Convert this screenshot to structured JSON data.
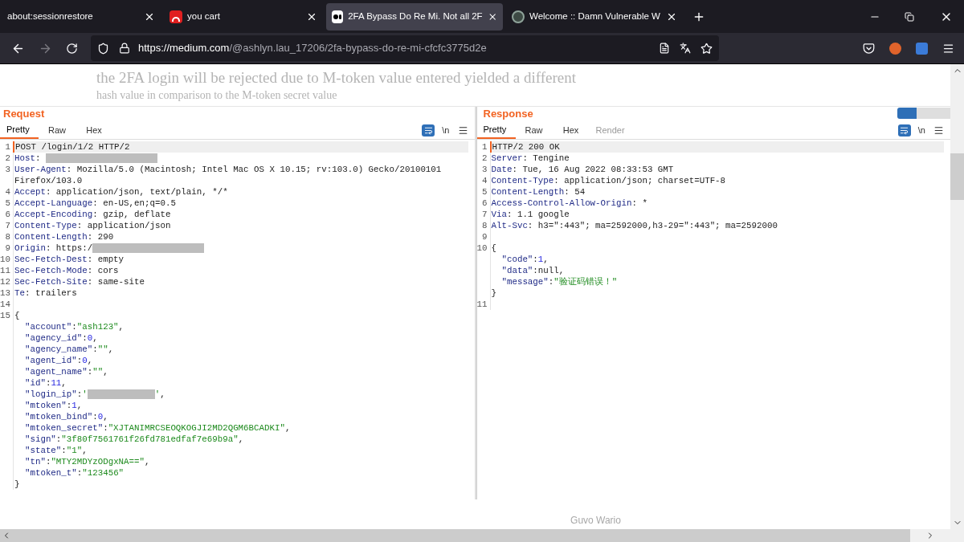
{
  "browser": {
    "tabs": [
      {
        "title": "about:sessionrestore",
        "selected": false,
        "kind": "plain"
      },
      {
        "title": "you cart",
        "selected": false,
        "kind": "cart"
      },
      {
        "title": "2FA Bypass Do Re Mi. Not all 2F",
        "selected": true,
        "kind": "medium"
      },
      {
        "title": "Welcome :: Damn Vulnerable W",
        "selected": false,
        "kind": "globe"
      }
    ],
    "url_host": "https://medium.com",
    "url_path": "/@ashlyn.lau_17206/2fa-bypass-do-re-mi-cfcfc3775d2e"
  },
  "article": {
    "lines": [
      "the 2FA login will be rejected due to M-token value entered yielded a different",
      "hash value in comparison to the M-token secret value"
    ],
    "footer_name": "Guvo Wario"
  },
  "request": {
    "title": "Request",
    "tabs": [
      {
        "label": "Pretty",
        "selected": true,
        "disabled": false
      },
      {
        "label": "Raw",
        "selected": false,
        "disabled": false
      },
      {
        "label": "Hex",
        "selected": false,
        "disabled": false
      }
    ],
    "newline_label": "\\n",
    "lines": [
      {
        "num": "1",
        "highlight": true,
        "parts": [
          {
            "kind": "text",
            "text": "POST /login/1/2 HTTP/2"
          }
        ]
      },
      {
        "num": "2",
        "parts": [
          {
            "kind": "key",
            "text": "Host"
          },
          {
            "kind": "text",
            "text": ": "
          },
          {
            "kind": "redacted"
          }
        ]
      },
      {
        "num": "3",
        "parts": [
          {
            "kind": "key",
            "text": "User-Agent"
          },
          {
            "kind": "text",
            "text": ": Mozilla/5.0 (Macintosh; Intel Mac OS X 10.15; rv:103.0) Gecko/20100101"
          }
        ]
      },
      {
        "parts": [
          {
            "kind": "text",
            "text": "Firefox/103.0"
          }
        ]
      },
      {
        "num": "4",
        "parts": [
          {
            "kind": "key",
            "text": "Accept"
          },
          {
            "kind": "text",
            "text": ": application/json, text/plain, */*"
          }
        ]
      },
      {
        "num": "5",
        "parts": [
          {
            "kind": "key",
            "text": "Accept-Language"
          },
          {
            "kind": "text",
            "text": ": en-US,en;q=0.5"
          }
        ]
      },
      {
        "num": "6",
        "parts": [
          {
            "kind": "key",
            "text": "Accept-Encoding"
          },
          {
            "kind": "text",
            "text": ": gzip, deflate"
          }
        ]
      },
      {
        "num": "7",
        "parts": [
          {
            "kind": "key",
            "text": "Content-Type"
          },
          {
            "kind": "text",
            "text": ": application/json"
          }
        ]
      },
      {
        "num": "8",
        "parts": [
          {
            "kind": "key",
            "text": "Content-Length"
          },
          {
            "kind": "text",
            "text": ": 290"
          }
        ]
      },
      {
        "num": "9",
        "parts": [
          {
            "kind": "key",
            "text": "Origin"
          },
          {
            "kind": "text",
            "text": ": https:/"
          },
          {
            "kind": "redacted"
          }
        ]
      },
      {
        "num": "10",
        "parts": [
          {
            "kind": "key",
            "text": "Sec-Fetch-Dest"
          },
          {
            "kind": "text",
            "text": ": empty"
          }
        ]
      },
      {
        "num": "11",
        "parts": [
          {
            "kind": "key",
            "text": "Sec-Fetch-Mode"
          },
          {
            "kind": "text",
            "text": ": cors"
          }
        ]
      },
      {
        "num": "12",
        "parts": [
          {
            "kind": "key",
            "text": "Sec-Fetch-Site"
          },
          {
            "kind": "text",
            "text": ": same-site"
          }
        ]
      },
      {
        "num": "13",
        "parts": [
          {
            "kind": "key",
            "text": "Te"
          },
          {
            "kind": "text",
            "text": ": trailers"
          }
        ]
      },
      {
        "num": "14"
      },
      {
        "num": "15",
        "parts": [
          {
            "kind": "text",
            "text": "{"
          }
        ]
      },
      {
        "parts": [
          {
            "kind": "key",
            "text": "  \"account\""
          },
          {
            "kind": "text",
            "text": ":"
          },
          {
            "kind": "string",
            "text": "\"ash123\""
          },
          {
            "kind": "text",
            "text": ","
          }
        ]
      },
      {
        "parts": [
          {
            "kind": "key",
            "text": "  \"agency_id\""
          },
          {
            "kind": "text",
            "text": ":"
          },
          {
            "kind": "number",
            "text": "0"
          },
          {
            "kind": "text",
            "text": ","
          }
        ]
      },
      {
        "parts": [
          {
            "kind": "key",
            "text": "  \"agency_name\""
          },
          {
            "kind": "text",
            "text": ":"
          },
          {
            "kind": "string",
            "text": "\"\""
          },
          {
            "kind": "text",
            "text": ","
          }
        ]
      },
      {
        "parts": [
          {
            "kind": "key",
            "text": "  \"agent_id\""
          },
          {
            "kind": "text",
            "text": ":"
          },
          {
            "kind": "number",
            "text": "0"
          },
          {
            "kind": "text",
            "text": ","
          }
        ]
      },
      {
        "parts": [
          {
            "kind": "key",
            "text": "  \"agent_name\""
          },
          {
            "kind": "text",
            "text": ":"
          },
          {
            "kind": "string",
            "text": "\"\""
          },
          {
            "kind": "text",
            "text": ","
          }
        ]
      },
      {
        "parts": [
          {
            "kind": "key",
            "text": "  \"id\""
          },
          {
            "kind": "text",
            "text": ":"
          },
          {
            "kind": "number",
            "text": "11"
          },
          {
            "kind": "text",
            "text": ","
          }
        ]
      },
      {
        "parts": [
          {
            "kind": "key",
            "text": "  \"login_ip\""
          },
          {
            "kind": "text",
            "text": ":"
          },
          {
            "kind": "string",
            "text": "'"
          },
          {
            "kind": "redacted"
          },
          {
            "kind": "string",
            "text": "'"
          },
          {
            "kind": "text",
            "text": ","
          }
        ]
      },
      {
        "parts": [
          {
            "kind": "key",
            "text": "  \"mtoken\""
          },
          {
            "kind": "text",
            "text": ":"
          },
          {
            "kind": "number",
            "text": "1"
          },
          {
            "kind": "text",
            "text": ","
          }
        ]
      },
      {
        "parts": [
          {
            "kind": "key",
            "text": "  \"mtoken_bind\""
          },
          {
            "kind": "text",
            "text": ":"
          },
          {
            "kind": "number",
            "text": "0"
          },
          {
            "kind": "text",
            "text": ","
          }
        ]
      },
      {
        "parts": [
          {
            "kind": "key",
            "text": "  \"mtoken_secret\""
          },
          {
            "kind": "text",
            "text": ":"
          },
          {
            "kind": "string",
            "text": "\"XJTANIMRCSEOQKOGJI2MD2QGM6BCADKI\""
          },
          {
            "kind": "text",
            "text": ","
          }
        ]
      },
      {
        "parts": [
          {
            "kind": "key",
            "text": "  \"sign\""
          },
          {
            "kind": "text",
            "text": ":"
          },
          {
            "kind": "string",
            "text": "\"3f80f7561761f26fd781edfaf7e69b9a\""
          },
          {
            "kind": "text",
            "text": ","
          }
        ]
      },
      {
        "parts": [
          {
            "kind": "key",
            "text": "  \"state\""
          },
          {
            "kind": "text",
            "text": ":"
          },
          {
            "kind": "string",
            "text": "\"1\""
          },
          {
            "kind": "text",
            "text": ","
          }
        ]
      },
      {
        "parts": [
          {
            "kind": "key",
            "text": "  \"tn\""
          },
          {
            "kind": "text",
            "text": ":"
          },
          {
            "kind": "string",
            "text": "\"MTY2MDYzODgxNA==\""
          },
          {
            "kind": "text",
            "text": ","
          }
        ]
      },
      {
        "parts": [
          {
            "kind": "key",
            "text": "  \"mtoken_t\""
          },
          {
            "kind": "text",
            "text": ":"
          },
          {
            "kind": "string",
            "text": "\"123456\""
          }
        ]
      },
      {
        "parts": [
          {
            "kind": "text",
            "text": "}"
          }
        ]
      }
    ]
  },
  "response": {
    "title": "Response",
    "tabs": [
      {
        "label": "Pretty",
        "selected": true,
        "disabled": false
      },
      {
        "label": "Raw",
        "selected": false,
        "disabled": false
      },
      {
        "label": "Hex",
        "selected": false,
        "disabled": false
      },
      {
        "label": "Render",
        "selected": false,
        "disabled": true
      }
    ],
    "newline_label": "\\n",
    "lines": [
      {
        "num": "1",
        "highlight": true,
        "parts": [
          {
            "kind": "text",
            "text": "HTTP/2 200 OK"
          }
        ]
      },
      {
        "num": "2",
        "parts": [
          {
            "kind": "key",
            "text": "Server"
          },
          {
            "kind": "text",
            "text": ": Tengine"
          }
        ]
      },
      {
        "num": "3",
        "parts": [
          {
            "kind": "key",
            "text": "Date"
          },
          {
            "kind": "text",
            "text": ": Tue, 16 Aug 2022 08:33:53 GMT"
          }
        ]
      },
      {
        "num": "4",
        "parts": [
          {
            "kind": "key",
            "text": "Content-Type"
          },
          {
            "kind": "text",
            "text": ": application/json; charset=UTF-8"
          }
        ]
      },
      {
        "num": "5",
        "parts": [
          {
            "kind": "key",
            "text": "Content-Length"
          },
          {
            "kind": "text",
            "text": ": 54"
          }
        ]
      },
      {
        "num": "6",
        "parts": [
          {
            "kind": "key",
            "text": "Access-Control-Allow-Origin"
          },
          {
            "kind": "text",
            "text": ": *"
          }
        ]
      },
      {
        "num": "7",
        "parts": [
          {
            "kind": "key",
            "text": "Via"
          },
          {
            "kind": "text",
            "text": ": 1.1 google"
          }
        ]
      },
      {
        "num": "8",
        "parts": [
          {
            "kind": "key",
            "text": "Alt-Svc"
          },
          {
            "kind": "text",
            "text": ": h3=\":443\"; ma=2592000,h3-29=\":443\"; ma=2592000"
          }
        ]
      },
      {
        "num": "9"
      },
      {
        "num": "10",
        "parts": [
          {
            "kind": "text",
            "text": "{"
          }
        ]
      },
      {
        "parts": [
          {
            "kind": "key",
            "text": "  \"code\""
          },
          {
            "kind": "text",
            "text": ":"
          },
          {
            "kind": "number",
            "text": "1"
          },
          {
            "kind": "text",
            "text": ","
          }
        ]
      },
      {
        "parts": [
          {
            "kind": "key",
            "text": "  \"data\""
          },
          {
            "kind": "text",
            "text": ":null,"
          }
        ]
      },
      {
        "parts": [
          {
            "kind": "key",
            "text": "  \"message\""
          },
          {
            "kind": "text",
            "text": ":"
          },
          {
            "kind": "string",
            "text": "\"验证码错误！\""
          }
        ]
      },
      {
        "parts": [
          {
            "kind": "text",
            "text": "}"
          }
        ]
      },
      {
        "num": "11"
      }
    ]
  }
}
